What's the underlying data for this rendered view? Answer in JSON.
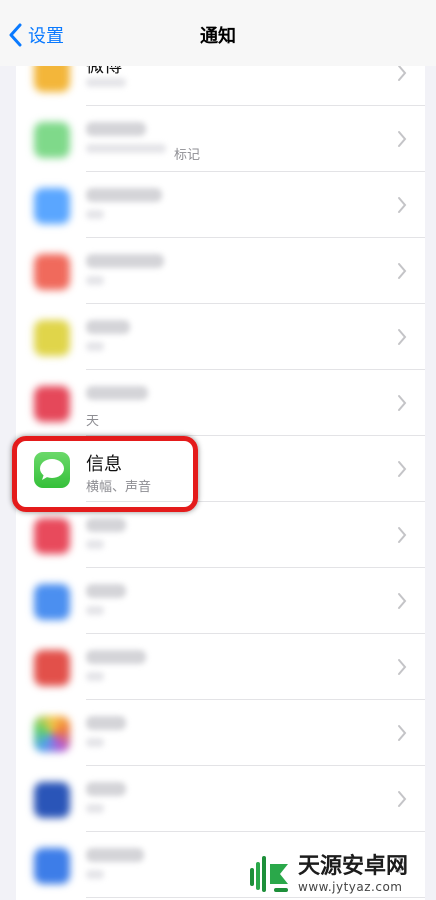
{
  "nav": {
    "back_label": "设置",
    "title": "通知"
  },
  "partial_rows": {
    "weibo_title": "微博",
    "reminder_peek": "标记",
    "tian_peek": "天"
  },
  "highlighted_row": {
    "title": "信息",
    "subtitle": "横幅、声音"
  },
  "watermark": {
    "name": "天源安卓网",
    "url": "www.jytyaz.com"
  },
  "colors": {
    "accent": "#0a7aff",
    "highlight_border": "#e41b1b",
    "messages_green": "#35c03a"
  }
}
